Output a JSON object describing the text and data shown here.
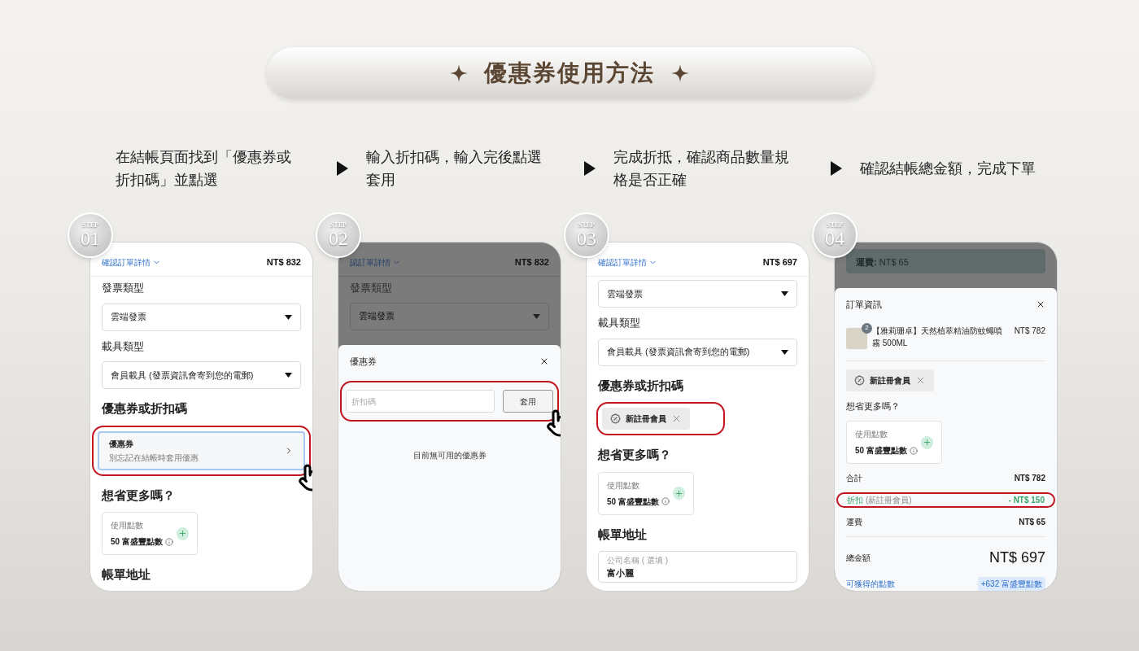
{
  "title": "優惠券使用方法",
  "steps": [
    {
      "text": "在結帳頁面找到「優惠券或折扣碼」並點選"
    },
    {
      "text": "輸入折扣碼，輸入完後點選套用"
    },
    {
      "text": "完成折抵，確認商品數量規格是否正確"
    },
    {
      "text": "確認結帳總金額，完成下單"
    }
  ],
  "phones": [
    {
      "step_label": "STEP",
      "step_number": "01",
      "kind": "page",
      "header": {
        "link": "確認訂單詳情",
        "total": "NT$ 832"
      },
      "blocks": [
        {
          "kind": "label",
          "text": "發票類型"
        },
        {
          "kind": "select",
          "value": "雲端發票"
        },
        {
          "kind": "label",
          "text": "載具類型"
        },
        {
          "kind": "select",
          "value": "會員載具 (發票資訊會寄到您的電郵)"
        },
        {
          "kind": "heading",
          "text": "優惠券或折扣碼"
        },
        {
          "kind": "coupon",
          "title": "優惠券",
          "subtitle": "別忘記在結帳時套用優惠",
          "highlighted": true,
          "tap": true
        },
        {
          "kind": "heading",
          "text": "想省更多嗎？"
        },
        {
          "kind": "points",
          "label": "使用點數",
          "value": "50 富盛豐點數"
        },
        {
          "kind": "heading",
          "text": "帳單地址"
        }
      ]
    },
    {
      "step_label": "STEP",
      "step_number": "02",
      "kind": "modal",
      "dim": {
        "header": {
          "link": "認訂單詳情",
          "total": "NT$ 832"
        },
        "blocks": [
          {
            "kind": "label",
            "text": "發票類型"
          },
          {
            "kind": "select",
            "value": "雲端發票"
          }
        ]
      },
      "modal": {
        "title": "優惠券",
        "blocks": [
          {
            "kind": "code_entry",
            "placeholder": "折扣碼",
            "button": "套用",
            "highlighted": true,
            "tap": true
          },
          {
            "kind": "note",
            "text": "目前無可用的優惠券"
          }
        ]
      }
    },
    {
      "step_label": "STEP",
      "step_number": "03",
      "kind": "page",
      "header": {
        "link": "確認訂單詳情",
        "total": "NT$ 697"
      },
      "blocks": [
        {
          "kind": "select",
          "value": "雲端發票"
        },
        {
          "kind": "label",
          "text": "載具類型"
        },
        {
          "kind": "select",
          "value": "會員載具 (發票資訊會寄到您的電郵)"
        },
        {
          "kind": "heading",
          "text": "優惠券或折扣碼"
        },
        {
          "kind": "chip",
          "text": "新註冊會員",
          "highlighted": true
        },
        {
          "kind": "heading",
          "text": "想省更多嗎？"
        },
        {
          "kind": "points",
          "label": "使用點數",
          "value": "50 富盛豐點數"
        },
        {
          "kind": "heading",
          "text": "帳單地址"
        },
        {
          "kind": "field",
          "label": "公司名稱 ( 選填 )",
          "value": "富小麗"
        }
      ]
    },
    {
      "step_label": "STEP",
      "step_number": "04",
      "kind": "modal",
      "dim": {
        "blocks": [
          {
            "kind": "bar",
            "text": "**運費:** NT$ 65"
          }
        ]
      },
      "modal": {
        "title": "訂單資訊",
        "blocks": [
          {
            "kind": "item",
            "quantity": "2",
            "name": "【雅莉珊卓】天然植萃精油防蚊蠅噴霧 500ML",
            "price": "NT$ 782"
          },
          {
            "kind": "chip",
            "text": "新註冊會員",
            "highlighted": false
          },
          {
            "kind": "subheading",
            "text": "想省更多嗎？"
          },
          {
            "kind": "points",
            "label": "使用點數",
            "value": "50 富盛豐點數"
          },
          {
            "kind": "line",
            "label": "合計",
            "value": "NT$ 782",
            "discount": false,
            "highlighted": false
          },
          {
            "kind": "line",
            "label": "折扣",
            "note": "(新註冊會員)",
            "value": "- NT$ 150",
            "discount": true,
            "highlighted": true
          },
          {
            "kind": "line",
            "label": "運費",
            "value": "NT$ 65",
            "discount": false,
            "highlighted": false
          },
          {
            "kind": "total",
            "label": "總金額",
            "value": "NT$ 697"
          },
          {
            "kind": "earn",
            "link": "可獲得的點數",
            "badge": "+632 富盛豐點數"
          }
        ]
      }
    }
  ]
}
